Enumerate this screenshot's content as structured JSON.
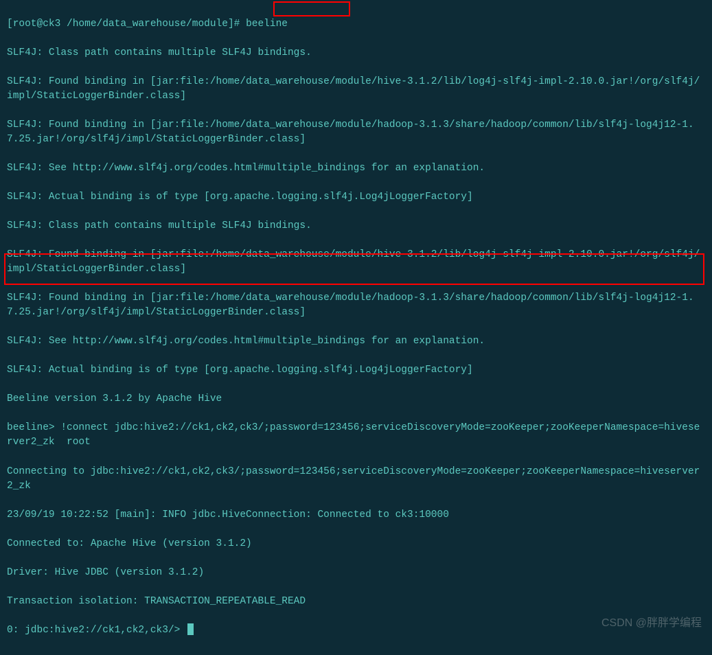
{
  "prompt1": {
    "prefix": "[root@ck3 /home/data_warehouse/module]# ",
    "command": "beeline"
  },
  "log_lines": [
    "SLF4J: Class path contains multiple SLF4J bindings.",
    "SLF4J: Found binding in [jar:file:/home/data_warehouse/module/hive-3.1.2/lib/log4j-slf4j-impl-2.10.0.jar!/org/slf4j/impl/StaticLoggerBinder.class]",
    "SLF4J: Found binding in [jar:file:/home/data_warehouse/module/hadoop-3.1.3/share/hadoop/common/lib/slf4j-log4j12-1.7.25.jar!/org/slf4j/impl/StaticLoggerBinder.class]",
    "SLF4J: See http://www.slf4j.org/codes.html#multiple_bindings for an explanation.",
    "SLF4J: Actual binding is of type [org.apache.logging.slf4j.Log4jLoggerFactory]",
    "SLF4J: Class path contains multiple SLF4J bindings.",
    "SLF4J: Found binding in [jar:file:/home/data_warehouse/module/hive-3.1.2/lib/log4j-slf4j-impl-2.10.0.jar!/org/slf4j/impl/StaticLoggerBinder.class]",
    "SLF4J: Found binding in [jar:file:/home/data_warehouse/module/hadoop-3.1.3/share/hadoop/common/lib/slf4j-log4j12-1.7.25.jar!/org/slf4j/impl/StaticLoggerBinder.class]",
    "SLF4J: See http://www.slf4j.org/codes.html#multiple_bindings for an explanation.",
    "SLF4J: Actual binding is of type [org.apache.logging.slf4j.Log4jLoggerFactory]",
    "Beeline version 3.1.2 by Apache Hive"
  ],
  "beeline_prompt": {
    "prefix": "beeline> ",
    "command": "!connect jdbc:hive2://ck1,ck2,ck3/;password=123456;serviceDiscoveryMode=zooKeeper;zooKeeperNamespace=hiveserver2_zk  root"
  },
  "connect_lines": [
    "Connecting to jdbc:hive2://ck1,ck2,ck3/;password=123456;serviceDiscoveryMode=zooKeeper;zooKeeperNamespace=hiveserver2_zk",
    "23/09/19 10:22:52 [main]: INFO jdbc.HiveConnection: Connected to ck3:10000",
    "Connected to: Apache Hive (version 3.1.2)",
    "Driver: Hive JDBC (version 3.1.2)",
    "Transaction isolation: TRANSACTION_REPEATABLE_READ"
  ],
  "final_prompt": "0: jdbc:hive2://ck1,ck2,ck3/> ",
  "watermark": "CSDN @胖胖学编程"
}
